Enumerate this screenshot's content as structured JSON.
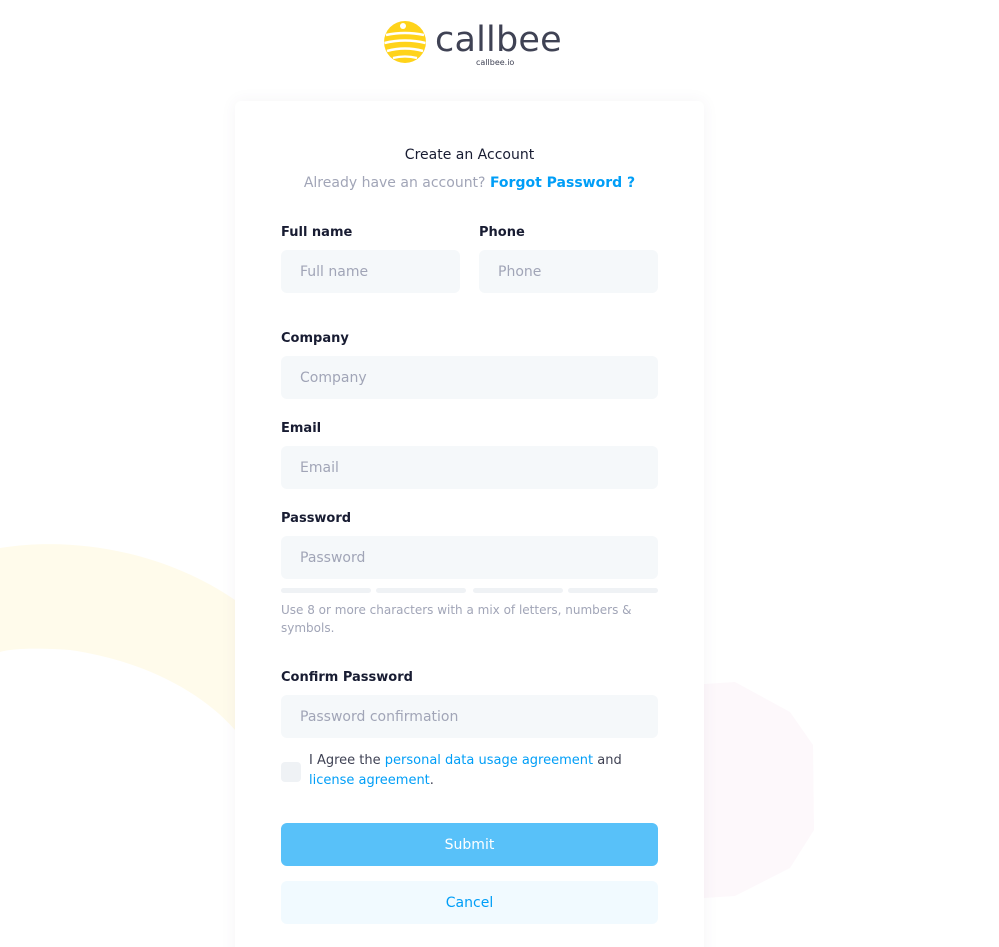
{
  "brand": {
    "name": "callbee",
    "domain": "callbee.io",
    "logo_color": "#ffd31a",
    "text_color": "#3f4254"
  },
  "form": {
    "title": "Create an Account",
    "subtitle_text": "Already have an account?",
    "subtitle_link": "Forgot Password ?",
    "fields": {
      "full_name": {
        "label": "Full name",
        "placeholder": "Full name",
        "value": ""
      },
      "phone": {
        "label": "Phone",
        "placeholder": "Phone",
        "value": ""
      },
      "company": {
        "label": "Company",
        "placeholder": "Company",
        "value": ""
      },
      "email": {
        "label": "Email",
        "placeholder": "Email",
        "value": ""
      },
      "password": {
        "label": "Password",
        "placeholder": "Password",
        "value": ""
      },
      "confirm_password": {
        "label": "Confirm Password",
        "placeholder": "Password confirmation",
        "value": ""
      }
    },
    "password_strength": {
      "filled_segments": 0,
      "total_segments": 4
    },
    "password_hint": "Use 8 or more characters with a mix of letters, numbers & symbols.",
    "agreement": {
      "checked": false,
      "prefix": "I Agree the",
      "link1": "personal data usage agreement",
      "middle": "and",
      "link2": "license agreement",
      "suffix": "."
    },
    "submit_label": "Submit",
    "cancel_label": "Cancel"
  },
  "colors": {
    "accent": "#009ef7",
    "submit_bg": "#58c1f9",
    "cancel_bg": "#f1faff",
    "input_bg": "#f5f8fa"
  }
}
